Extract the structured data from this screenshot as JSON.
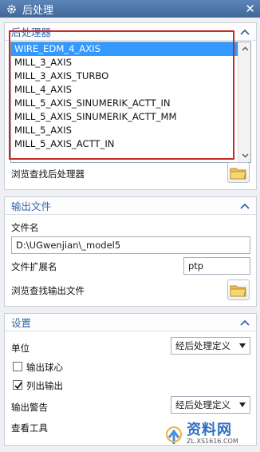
{
  "window": {
    "title": "后处理",
    "gear_icon": "gear-icon",
    "close_icon": "close-icon",
    "close_glyph": "✕"
  },
  "postprocessor": {
    "header": "后处理器",
    "items": [
      "WIRE_EDM_4_AXIS",
      "MILL_3_AXIS",
      "MILL_3_AXIS_TURBO",
      "MILL_4_AXIS",
      "MILL_5_AXIS_SINUMERIK_ACTT_IN",
      "MILL_5_AXIS_SINUMERIK_ACTT_MM",
      "MILL_5_AXIS",
      "MILL_5_AXIS_ACTT_IN"
    ],
    "selected_index": 0,
    "browse_label": "浏览查找后处理器"
  },
  "output": {
    "header": "输出文件",
    "filename_label": "文件名",
    "filename_value": "D:\\UGwenjian\\_model5",
    "ext_label": "文件扩展名",
    "ext_value": "ptp",
    "browse_label": "浏览查找输出文件"
  },
  "settings": {
    "header": "设置",
    "units_label": "单位",
    "units_value": "经后处理定义",
    "output_ball_label": "输出球心",
    "output_ball_checked": false,
    "list_output_label": "列出输出",
    "list_output_checked": true,
    "warnings_label": "输出警告",
    "warnings_value": "经后处理定义",
    "review_tool_label": "查看工具"
  },
  "watermark": {
    "text": "资料网",
    "url": "ZL.XS1616.COM"
  },
  "colors": {
    "title_bar": "#4a74a8",
    "section_header": "#3467a6",
    "selection": "#3399ff",
    "highlight_box": "#c82828"
  }
}
